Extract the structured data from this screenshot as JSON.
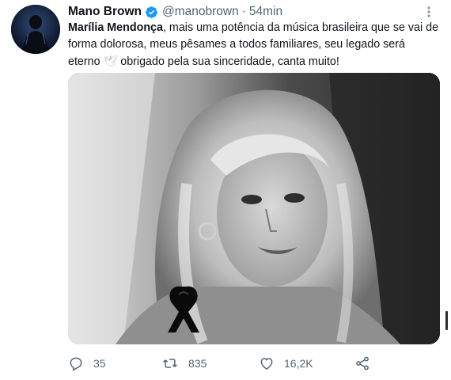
{
  "tweet": {
    "author": {
      "display_name": "Mano Brown",
      "handle": "@manobrown",
      "verified": true,
      "avatar_icon": "person-silhouette"
    },
    "separator": "·",
    "time": "54min",
    "text": {
      "bold_lead": "Marília Mendonça",
      "part1": ", mais uma potência da música brasileira que se vai de forma dolorosa, meus pêsames a todos familiares, seu legado será eterno ",
      "emoji": "🕊",
      "part2": " obrigado pela sua sinceridade, canta muito!"
    },
    "media": {
      "icon": "mourning-ribbon"
    },
    "actions": {
      "reply": {
        "icon": "reply-icon",
        "count": "35"
      },
      "retweet": {
        "icon": "retweet-icon",
        "count": "835"
      },
      "like": {
        "icon": "heart-icon",
        "count": "16,2K"
      },
      "share": {
        "icon": "share-icon"
      }
    },
    "colors": {
      "verified_blue": "#1d9bf0",
      "secondary_text": "#536471",
      "primary_text": "#0f1419"
    }
  }
}
